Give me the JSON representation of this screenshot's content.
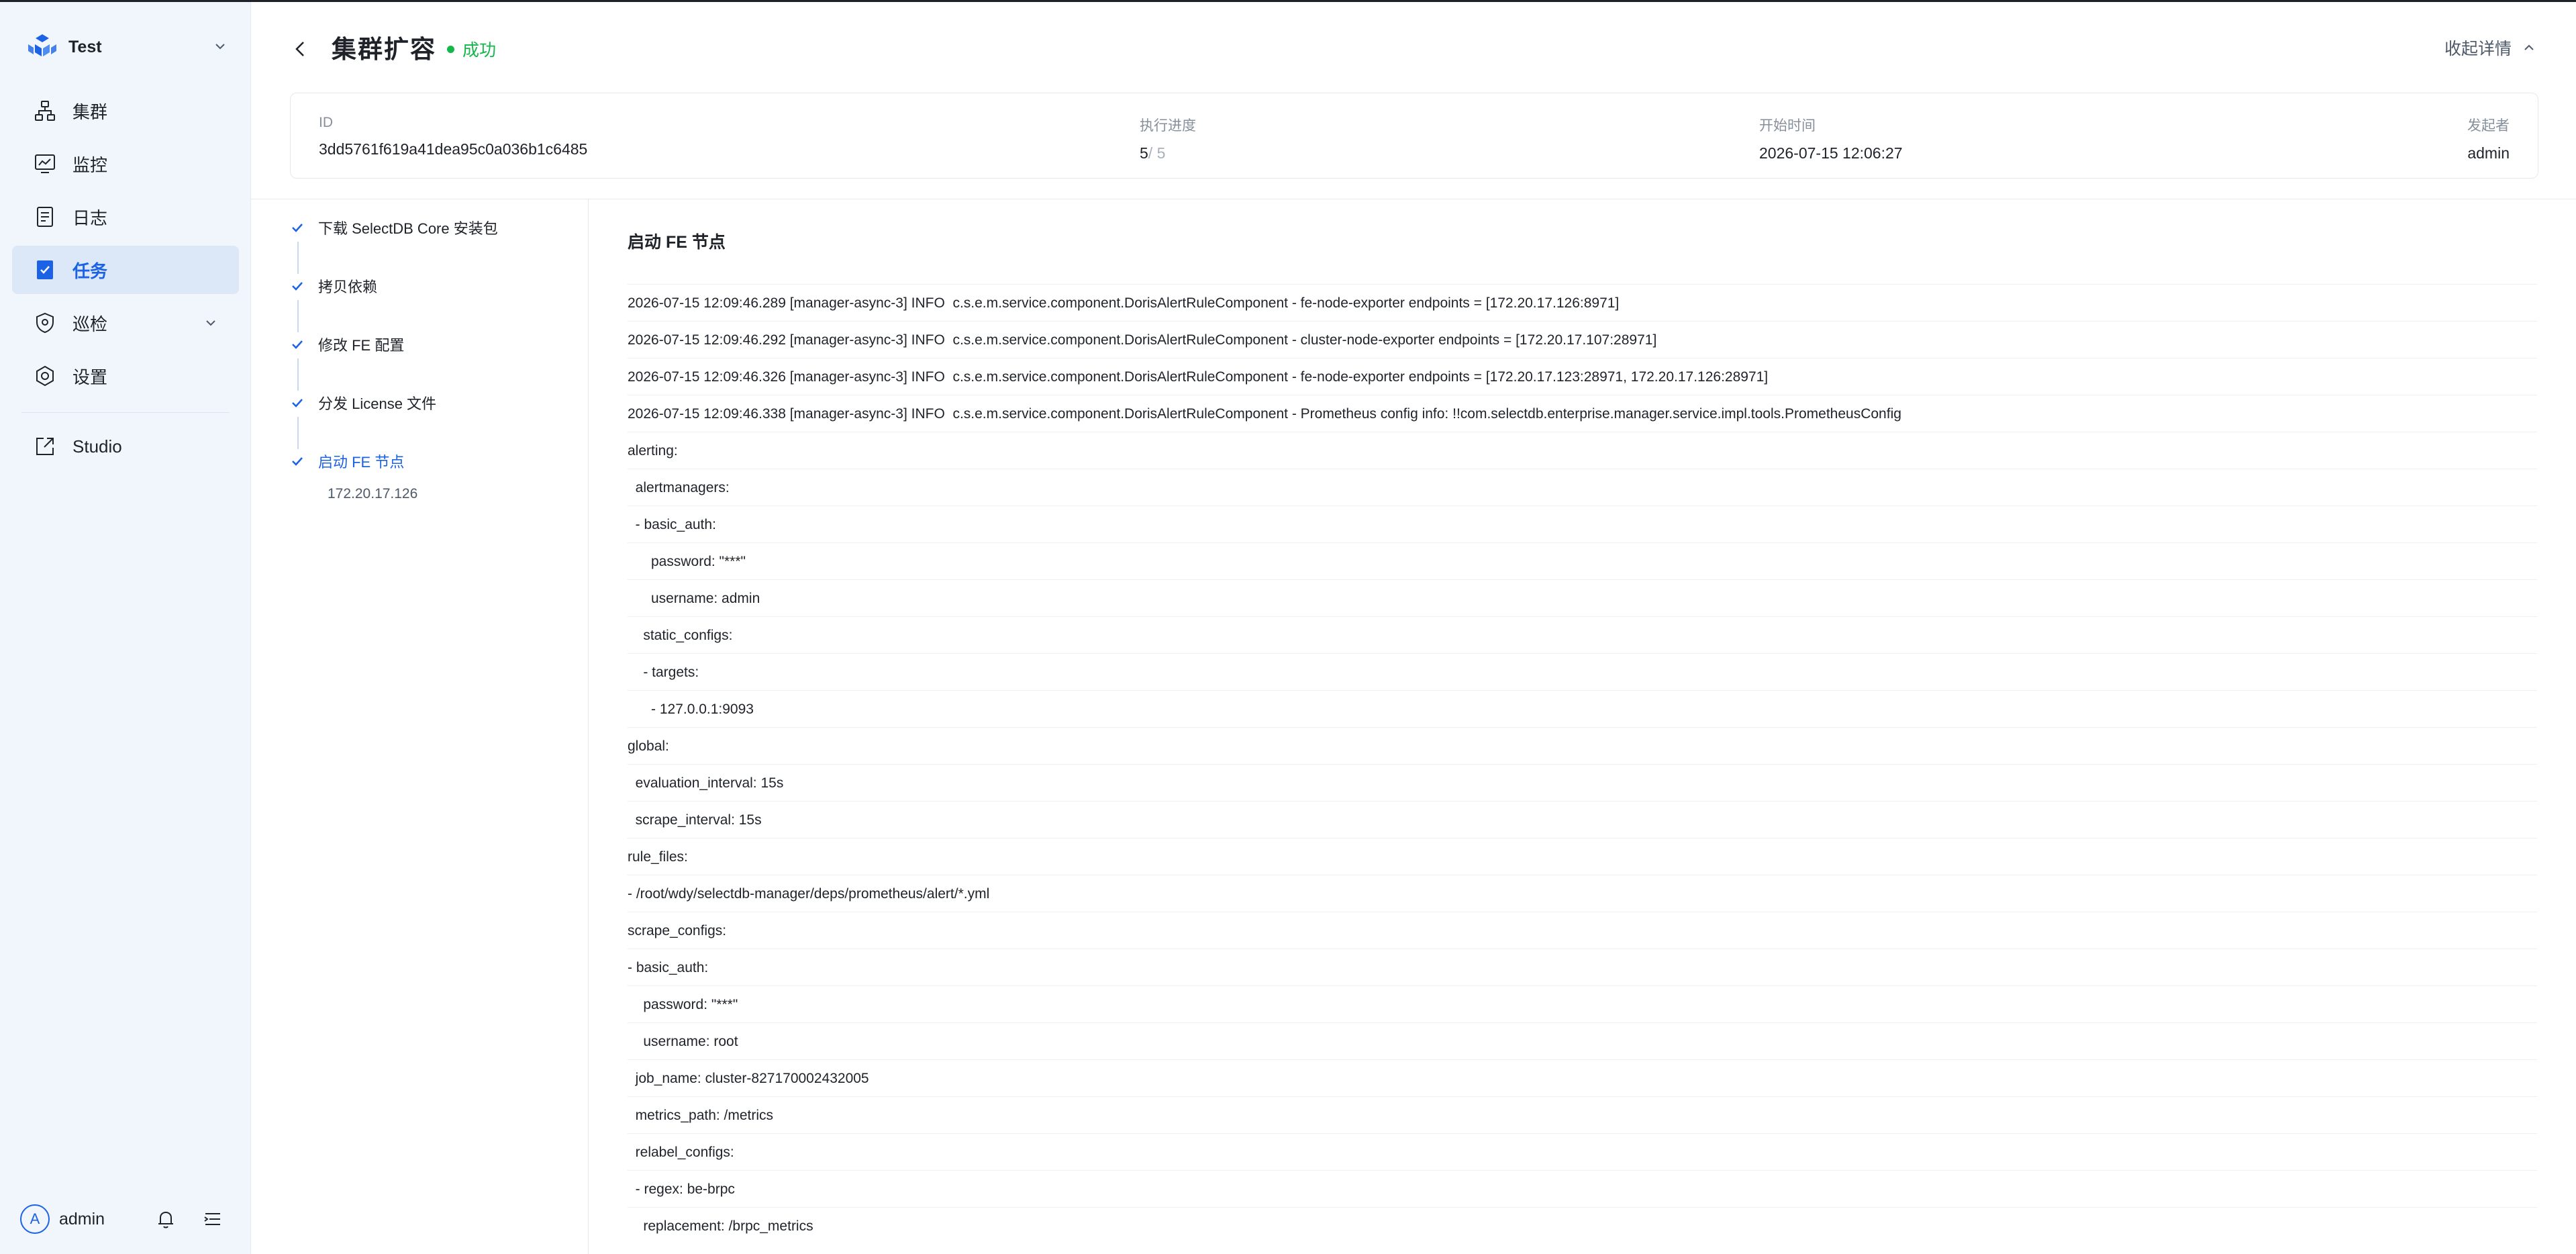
{
  "sidebar": {
    "workspace": "Test",
    "items": [
      {
        "label": "集群",
        "icon": "cluster-icon",
        "active": false
      },
      {
        "label": "监控",
        "icon": "monitor-icon",
        "active": false
      },
      {
        "label": "日志",
        "icon": "log-icon",
        "active": false
      },
      {
        "label": "任务",
        "icon": "task-icon",
        "active": true
      },
      {
        "label": "巡检",
        "icon": "inspection-icon",
        "active": false,
        "expandable": true
      },
      {
        "label": "设置",
        "icon": "gear-icon",
        "active": false
      }
    ],
    "studio_label": "Studio",
    "user": {
      "avatar_letter": "A",
      "name": "admin"
    }
  },
  "header": {
    "title": "集群扩容",
    "status": "成功",
    "collapse_label": "收起详情"
  },
  "info": {
    "id_label": "ID",
    "id_value": "3dd5761f619a41dea95c0a036b1c6485",
    "progress_label": "执行进度",
    "progress_done": "5",
    "progress_total": "/ 5",
    "start_label": "开始时间",
    "start_value": "2026-07-15 12:06:27",
    "initiator_label": "发起者",
    "initiator_value": "admin"
  },
  "steps": [
    {
      "label": "下载 SelectDB Core 安装包"
    },
    {
      "label": "拷贝依赖"
    },
    {
      "label": "修改 FE 配置"
    },
    {
      "label": "分发 License 文件"
    },
    {
      "label": "启动 FE 节点",
      "active": true,
      "sub": "172.20.17.126"
    }
  ],
  "log": {
    "title": "启动 FE 节点",
    "lines": [
      "2026-07-15 12:09:46.289 [manager-async-3] INFO  c.s.e.m.service.component.DorisAlertRuleComponent - fe-node-exporter endpoints = [172.20.17.126:8971]",
      "2026-07-15 12:09:46.292 [manager-async-3] INFO  c.s.e.m.service.component.DorisAlertRuleComponent - cluster-node-exporter endpoints = [172.20.17.107:28971]",
      "2026-07-15 12:09:46.326 [manager-async-3] INFO  c.s.e.m.service.component.DorisAlertRuleComponent - fe-node-exporter endpoints = [172.20.17.123:28971, 172.20.17.126:28971]",
      "2026-07-15 12:09:46.338 [manager-async-3] INFO  c.s.e.m.service.component.DorisAlertRuleComponent - Prometheus config info: !!com.selectdb.enterprise.manager.service.impl.tools.PrometheusConfig",
      "alerting:",
      "  alertmanagers:",
      "  - basic_auth:",
      "      password: \"***\"",
      "      username: admin",
      "    static_configs:",
      "    - targets:",
      "      - 127.0.0.1:9093",
      "global:",
      "  evaluation_interval: 15s",
      "  scrape_interval: 15s",
      "rule_files:",
      "- /root/wdy/selectdb-manager/deps/prometheus/alert/*.yml",
      "scrape_configs:",
      "- basic_auth:",
      "    password: \"***\"",
      "    username: root",
      "  job_name: cluster-827170002432005",
      "  metrics_path: /metrics",
      "  relabel_configs:",
      "  - regex: be-brpc",
      "    replacement: /brpc_metrics"
    ]
  },
  "colors": {
    "accent": "#1b63e4",
    "success": "#15b64a",
    "sidebar_bg": "#f1f6fd"
  }
}
